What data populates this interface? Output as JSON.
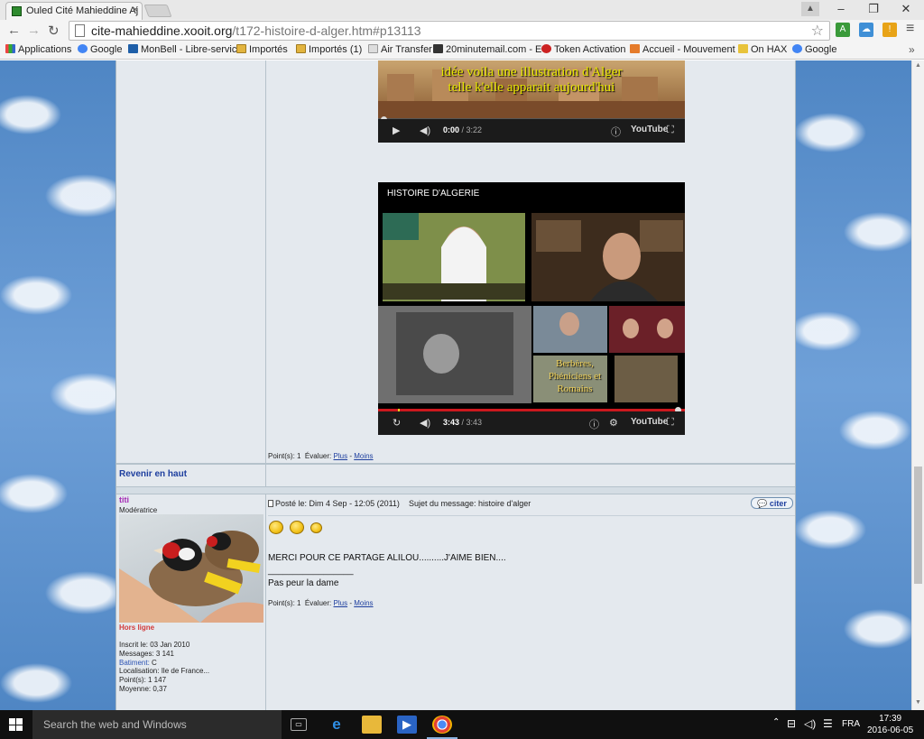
{
  "browser": {
    "tab_title": "Ouled Cité Mahieddine Aj",
    "tab_close": "×",
    "url_host": "cite-mahieddine.xooit.org",
    "url_path": "/t172-histoire-d-alger.htm#p13113",
    "window_controls": {
      "minimize": "–",
      "restore": "❐",
      "close": "✕"
    }
  },
  "bookmarks": [
    {
      "label": "Applications",
      "icon": "apps-grid-icon"
    },
    {
      "label": "Google",
      "icon": "google-icon"
    },
    {
      "label": "MonBell - Libre-servic",
      "icon": "bell-icon"
    },
    {
      "label": "Importés",
      "icon": "folder-icon"
    },
    {
      "label": "Importés (1)",
      "icon": "folder-icon"
    },
    {
      "label": "Air Transfer",
      "icon": "page-icon"
    },
    {
      "label": "20minutemail.com - E",
      "icon": "page-icon"
    },
    {
      "label": "Token Activation",
      "icon": "page-icon"
    },
    {
      "label": "Accueil - Mouvement",
      "icon": "page-icon"
    },
    {
      "label": "On HAX",
      "icon": "page-icon"
    },
    {
      "label": "Google",
      "icon": "google-icon"
    }
  ],
  "video1": {
    "overlay_line1": "idée voila une illustration d'Alger",
    "overlay_line2": "telle k'elle apparait aujourd'hui",
    "time_current": "0:00",
    "time_total": " / 3:22",
    "progress": 0.0,
    "logo": "YouTube"
  },
  "video2": {
    "title": "HISTOIRE D'ALGERIE",
    "caption": "Berbères, Phéniciens et Romains",
    "time_current": "3:43",
    "time_total": " / 3:43",
    "progress": 1.0,
    "logo": "YouTube"
  },
  "post1": {
    "points_label": "Point(s): 1",
    "evaluer_label": "Évaluer:",
    "plus": "Plus",
    "dash": "-",
    "moins": "Moins"
  },
  "back_to_top": "Revenir en haut",
  "post2": {
    "author": "titi",
    "rank": "Modératrice",
    "status": "Hors ligne",
    "posted_label": "Posté le:",
    "posted_date": "Dim 4 Sep - 12:05 (2011)",
    "subject_label": "Sujet du message:",
    "subject": "histoire d'alger",
    "quote_button": "citer",
    "message": "MERCI POUR CE PARTAGE ALILOU..........J'AIME BIEN....",
    "signature_rule": "_________________",
    "signature": "Pas peur la dame",
    "points_label": "Point(s): 1",
    "evaluer_label": "Évaluer:",
    "plus": "Plus",
    "dash": "-",
    "moins": "Moins",
    "user_info": {
      "inscrit": "Inscrit le: 03 Jan 2010",
      "messages": "Messages: 3 141",
      "batiment_label": "Batiment:",
      "batiment_value": " C",
      "localisation": "Localisation: Ile de France...",
      "points": "Point(s): 1 147",
      "moyenne": "Moyenne: 0,37"
    }
  },
  "taskbar": {
    "search_placeholder": "Search the web and Windows",
    "language": "FRA",
    "time": "17:39",
    "date": "2016-06-05"
  }
}
